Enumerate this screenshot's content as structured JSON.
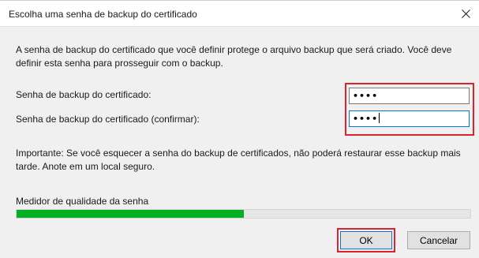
{
  "dialog": {
    "title": "Escolha uma senha de backup do certificado",
    "close_icon": "close-icon",
    "description": "A senha de backup do certificado que você definir protege o arquivo backup que será criado. Você deve definir esta senha para prosseguir com o backup.",
    "password_label": "Senha de backup do certificado:",
    "password_value": "••••",
    "confirm_label": "Senha de backup do certificado (confirmar):",
    "confirm_value": "••••",
    "important_text": "Importante: Se você esquecer a senha do backup de certificados, não poderá restaurar esse backup mais tarde. Anote em um local seguro.",
    "meter": {
      "label": "Medidor de qualidade da senha",
      "quality_fraction": 0.5,
      "color": "#06b025"
    },
    "buttons": {
      "ok_label": "OK",
      "cancel_label": "Cancelar"
    },
    "highlight_color": "#d9232e",
    "focus_color": "#0078d7"
  }
}
